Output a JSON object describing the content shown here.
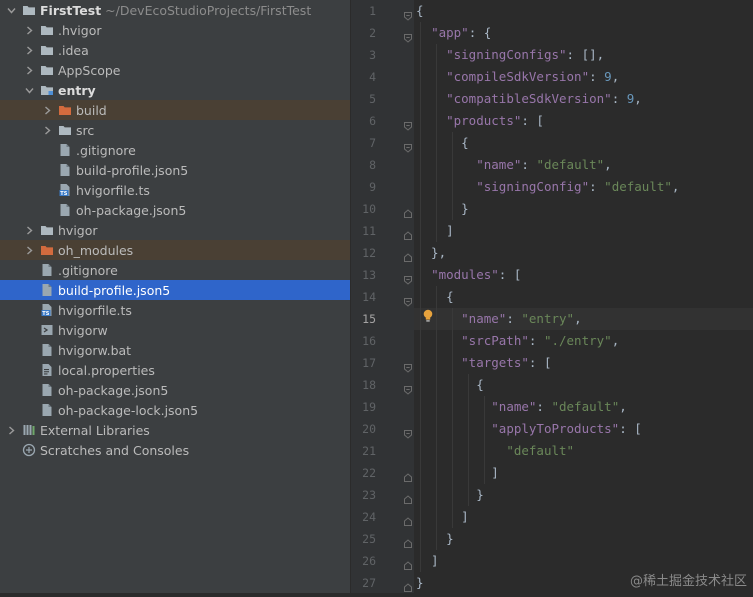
{
  "project_tree": {
    "rows": [
      {
        "name": "FirstTest",
        "path": "~/DevEcoStudioProjects/FirstTest",
        "icon": "folder-icon",
        "expanded": true
      },
      {
        "name": ".hvigor",
        "icon": "folder-icon",
        "expanded": false
      },
      {
        "name": ".idea",
        "icon": "folder-icon",
        "expanded": false
      },
      {
        "name": "AppScope",
        "icon": "folder-icon",
        "expanded": false
      },
      {
        "name": "entry",
        "icon": "module-folder-icon",
        "expanded": true
      },
      {
        "name": "build",
        "icon": "excluded-folder-icon",
        "expanded": false
      },
      {
        "name": "src",
        "icon": "folder-icon",
        "expanded": false
      },
      {
        "name": ".gitignore",
        "icon": "file-icon"
      },
      {
        "name": "build-profile.json5",
        "icon": "file-icon"
      },
      {
        "name": "hvigorfile.ts",
        "icon": "ts-file-icon"
      },
      {
        "name": "oh-package.json5",
        "icon": "file-icon"
      },
      {
        "name": "hvigor",
        "icon": "folder-icon",
        "expanded": false
      },
      {
        "name": "oh_modules",
        "icon": "excluded-folder-icon",
        "expanded": false
      },
      {
        "name": ".gitignore",
        "icon": "file-icon"
      },
      {
        "name": "build-profile.json5",
        "icon": "file-icon"
      },
      {
        "name": "hvigorfile.ts",
        "icon": "ts-file-icon"
      },
      {
        "name": "hvigorw",
        "icon": "shell-file-icon"
      },
      {
        "name": "hvigorw.bat",
        "icon": "file-icon"
      },
      {
        "name": "local.properties",
        "icon": "properties-file-icon"
      },
      {
        "name": "oh-package.json5",
        "icon": "file-icon"
      },
      {
        "name": "oh-package-lock.json5",
        "icon": "file-icon"
      },
      {
        "name": "External Libraries",
        "icon": "libraries-icon",
        "expanded": false
      },
      {
        "name": "Scratches and Consoles",
        "icon": "scratches-icon"
      }
    ]
  },
  "editor": {
    "current_line": 15,
    "line_numbers": [
      "1",
      "2",
      "3",
      "4",
      "5",
      "6",
      "7",
      "8",
      "9",
      "10",
      "11",
      "12",
      "13",
      "14",
      "15",
      "16",
      "17",
      "18",
      "19",
      "20",
      "21",
      "22",
      "23",
      "24",
      "25",
      "26",
      "27"
    ],
    "lines": [
      [
        [
          "pun",
          "{"
        ]
      ],
      [
        [
          "pun",
          "  "
        ],
        [
          "key",
          "\"app\""
        ],
        [
          "pun",
          ": {"
        ]
      ],
      [
        [
          "pun",
          "    "
        ],
        [
          "key",
          "\"signingConfigs\""
        ],
        [
          "pun",
          ": [],"
        ]
      ],
      [
        [
          "pun",
          "    "
        ],
        [
          "key",
          "\"compileSdkVersion\""
        ],
        [
          "pun",
          ": "
        ],
        [
          "num",
          "9"
        ],
        [
          "pun",
          ","
        ]
      ],
      [
        [
          "pun",
          "    "
        ],
        [
          "key",
          "\"compatibleSdkVersion\""
        ],
        [
          "pun",
          ": "
        ],
        [
          "num",
          "9"
        ],
        [
          "pun",
          ","
        ]
      ],
      [
        [
          "pun",
          "    "
        ],
        [
          "key",
          "\"products\""
        ],
        [
          "pun",
          ": ["
        ]
      ],
      [
        [
          "pun",
          "      {"
        ]
      ],
      [
        [
          "pun",
          "        "
        ],
        [
          "key",
          "\"name\""
        ],
        [
          "pun",
          ": "
        ],
        [
          "str",
          "\"default\""
        ],
        [
          "pun",
          ","
        ]
      ],
      [
        [
          "pun",
          "        "
        ],
        [
          "key",
          "\"signingConfig\""
        ],
        [
          "pun",
          ": "
        ],
        [
          "str",
          "\"default\""
        ],
        [
          "pun",
          ","
        ]
      ],
      [
        [
          "pun",
          "      }"
        ]
      ],
      [
        [
          "pun",
          "    ]"
        ]
      ],
      [
        [
          "pun",
          "  },"
        ]
      ],
      [
        [
          "pun",
          "  "
        ],
        [
          "key",
          "\"modules\""
        ],
        [
          "pun",
          ": ["
        ]
      ],
      [
        [
          "pun",
          "    {"
        ]
      ],
      [
        [
          "pun",
          "      "
        ],
        [
          "key",
          "\"name\""
        ],
        [
          "pun",
          ": "
        ],
        [
          "str",
          "\"entry\""
        ],
        [
          "pun",
          ","
        ]
      ],
      [
        [
          "pun",
          "      "
        ],
        [
          "key",
          "\"srcPath\""
        ],
        [
          "pun",
          ": "
        ],
        [
          "str",
          "\"./entry\""
        ],
        [
          "pun",
          ","
        ]
      ],
      [
        [
          "pun",
          "      "
        ],
        [
          "key",
          "\"targets\""
        ],
        [
          "pun",
          ": ["
        ]
      ],
      [
        [
          "pun",
          "        {"
        ]
      ],
      [
        [
          "pun",
          "          "
        ],
        [
          "key",
          "\"name\""
        ],
        [
          "pun",
          ": "
        ],
        [
          "str",
          "\"default\""
        ],
        [
          "pun",
          ","
        ]
      ],
      [
        [
          "pun",
          "          "
        ],
        [
          "key",
          "\"applyToProducts\""
        ],
        [
          "pun",
          ": ["
        ]
      ],
      [
        [
          "pun",
          "            "
        ],
        [
          "str",
          "\"default\""
        ]
      ],
      [
        [
          "pun",
          "          ]"
        ]
      ],
      [
        [
          "pun",
          "        }"
        ]
      ],
      [
        [
          "pun",
          "      ]"
        ]
      ],
      [
        [
          "pun",
          "    }"
        ]
      ],
      [
        [
          "pun",
          "  ]"
        ]
      ],
      [
        [
          "pun",
          "}"
        ]
      ]
    ]
  },
  "watermark": "@稀土掘金技术社区",
  "colors": {
    "key": "#9876aa",
    "string": "#6a8759",
    "number": "#6897bb",
    "selection": "#2f65ca",
    "excluded": "#4a4034"
  }
}
